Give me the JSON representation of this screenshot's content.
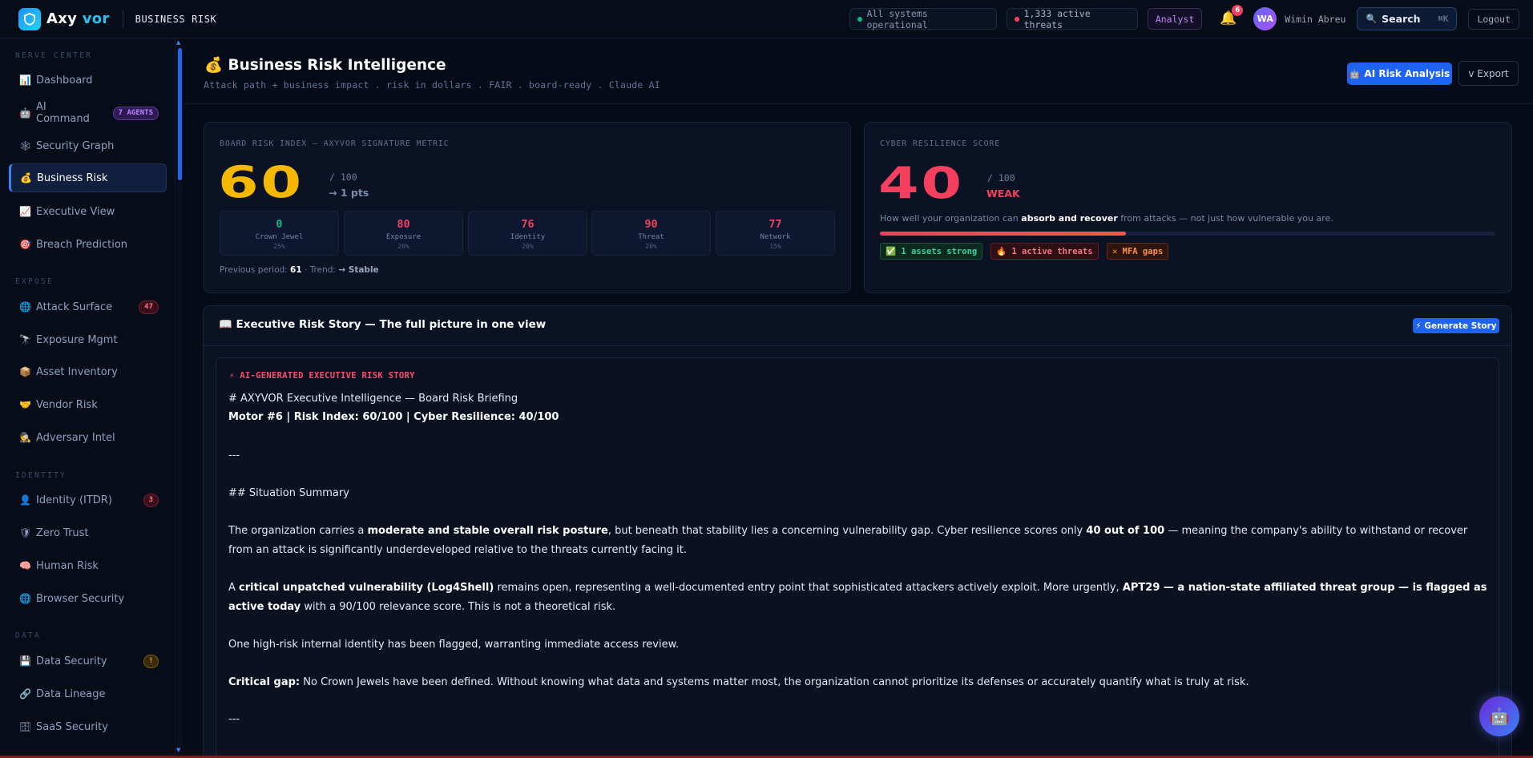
{
  "topbar": {
    "brand_a": "Axy",
    "brand_b": "vor",
    "page": "BUSINESS RISK",
    "status": "All systems operational",
    "threats": "1,333 active threats",
    "role": "Analyst",
    "notif_count": "6",
    "avatar_initials": "WA",
    "user_name": "Wimin Abreu",
    "search_label": "Search",
    "search_shortcut": "⌘K",
    "logout": "Logout"
  },
  "sidebar": {
    "sections": [
      "NERVE CENTER",
      "EXPOSE",
      "IDENTITY",
      "DATA"
    ],
    "items": [
      {
        "label": "Dashboard",
        "icon": "📊"
      },
      {
        "label": "AI Command",
        "icon": "🤖",
        "badge": "7 AGENTS"
      },
      {
        "label": "Security Graph",
        "icon": "🕸"
      },
      {
        "label": "Business Risk",
        "icon": "💰"
      },
      {
        "label": "Executive View",
        "icon": "📈"
      },
      {
        "label": "Breach Prediction",
        "icon": "🎯"
      },
      {
        "label": "Attack Surface",
        "icon": "🌐",
        "badge": "47"
      },
      {
        "label": "Exposure Mgmt",
        "icon": "🔭"
      },
      {
        "label": "Asset Inventory",
        "icon": "📦"
      },
      {
        "label": "Vendor Risk",
        "icon": "🤝"
      },
      {
        "label": "Adversary Intel",
        "icon": "🕵"
      },
      {
        "label": "Identity (ITDR)",
        "icon": "👤",
        "badge": "3"
      },
      {
        "label": "Zero Trust",
        "icon": "🛡"
      },
      {
        "label": "Human Risk",
        "icon": "🧠"
      },
      {
        "label": "Browser Security",
        "icon": "🌐"
      },
      {
        "label": "Data Security",
        "icon": "💾",
        "badge": "!"
      },
      {
        "label": "Data Lineage",
        "icon": "🔗"
      },
      {
        "label": "SaaS Security",
        "icon": "🗄"
      }
    ]
  },
  "header": {
    "icon": "💰",
    "title": "Business Risk Intelligence",
    "subtitle": "Attack path + business impact . risk in dollars . FAIR . board-ready . Claude AI",
    "ai_button": "AI Risk Analysis",
    "export_button": "v Export"
  },
  "risk_index": {
    "label": "BOARD RISK INDEX — AXYVOR SIGNATURE METRIC",
    "value": "60",
    "max": "/ 100",
    "delta": "→ 1 pts",
    "factors": [
      {
        "value": "0",
        "name": "Crown Jewel",
        "weight": "25%",
        "color": "#10b981"
      },
      {
        "value": "80",
        "name": "Exposure",
        "weight": "20%",
        "color": "#f43f5e"
      },
      {
        "value": "76",
        "name": "Identity",
        "weight": "20%",
        "color": "#f43f5e"
      },
      {
        "value": "90",
        "name": "Threat",
        "weight": "20%",
        "color": "#f43f5e"
      },
      {
        "value": "77",
        "name": "Network",
        "weight": "15%",
        "color": "#f43f5e"
      }
    ],
    "prev_label": "Previous period:",
    "prev_value": "61",
    "trend_label": "· Trend:",
    "trend_value": "→ Stable"
  },
  "resilience": {
    "label": "CYBER RESILIENCE SCORE",
    "value": "40",
    "max": "/ 100",
    "rating": "WEAK",
    "desc_a": "How well your organization can",
    "desc_b": "absorb and recover",
    "desc_c": "from attacks — not just how vulnerable you are.",
    "progress": 0.4,
    "tags": [
      "✅ 1 assets strong",
      "🔥 1 active threats",
      "✕ MFA gaps"
    ]
  },
  "story": {
    "icon": "📖",
    "title": "Executive Risk Story — The full picture in one view",
    "generate_button": "⚡ Generate Story",
    "tag": "⚡ AI-GENERATED EXECUTIVE RISK STORY",
    "heading": "# AXYVOR Executive Intelligence — Board Risk Briefing",
    "meta": "Motor #6 | Risk Index: 60/100 | Cyber Resilience: 40/100",
    "hr1": "---",
    "summary_heading": "## Situation Summary",
    "p1_a": "The organization carries a",
    "p1_b": "moderate and stable overall risk posture",
    "p1_c": ", but beneath that stability lies a concerning vulnerability gap. Cyber resilience scores only",
    "p1_d": "40 out of 100",
    "p1_e": "— meaning the company's ability to withstand or recover from an attack is significantly underdeveloped relative to the threats currently facing it.",
    "p2_a": "A",
    "p2_b": "critical unpatched vulnerability (Log4Shell)",
    "p2_c": "remains open, representing a well-documented entry point that sophisticated attackers actively exploit. More urgently,",
    "p2_d": "APT29 — a nation-state affiliated threat group — is flagged as active today",
    "p2_e": "with a 90/100 relevance score. This is not a theoretical risk.",
    "p3": "One high-risk internal identity has been flagged, warranting immediate access review.",
    "p4_a": "Critical gap:",
    "p4_b": "No Crown Jewels have been defined. Without knowing what data and systems matter most, the organization cannot prioritize its defenses or accurately quantify what is truly at risk.",
    "hr2": "---"
  },
  "colors": {
    "accent": "#1d63f0",
    "risk_index": "#f5b800",
    "resilience": "#f43f5e",
    "status_ok": "#10b981"
  }
}
